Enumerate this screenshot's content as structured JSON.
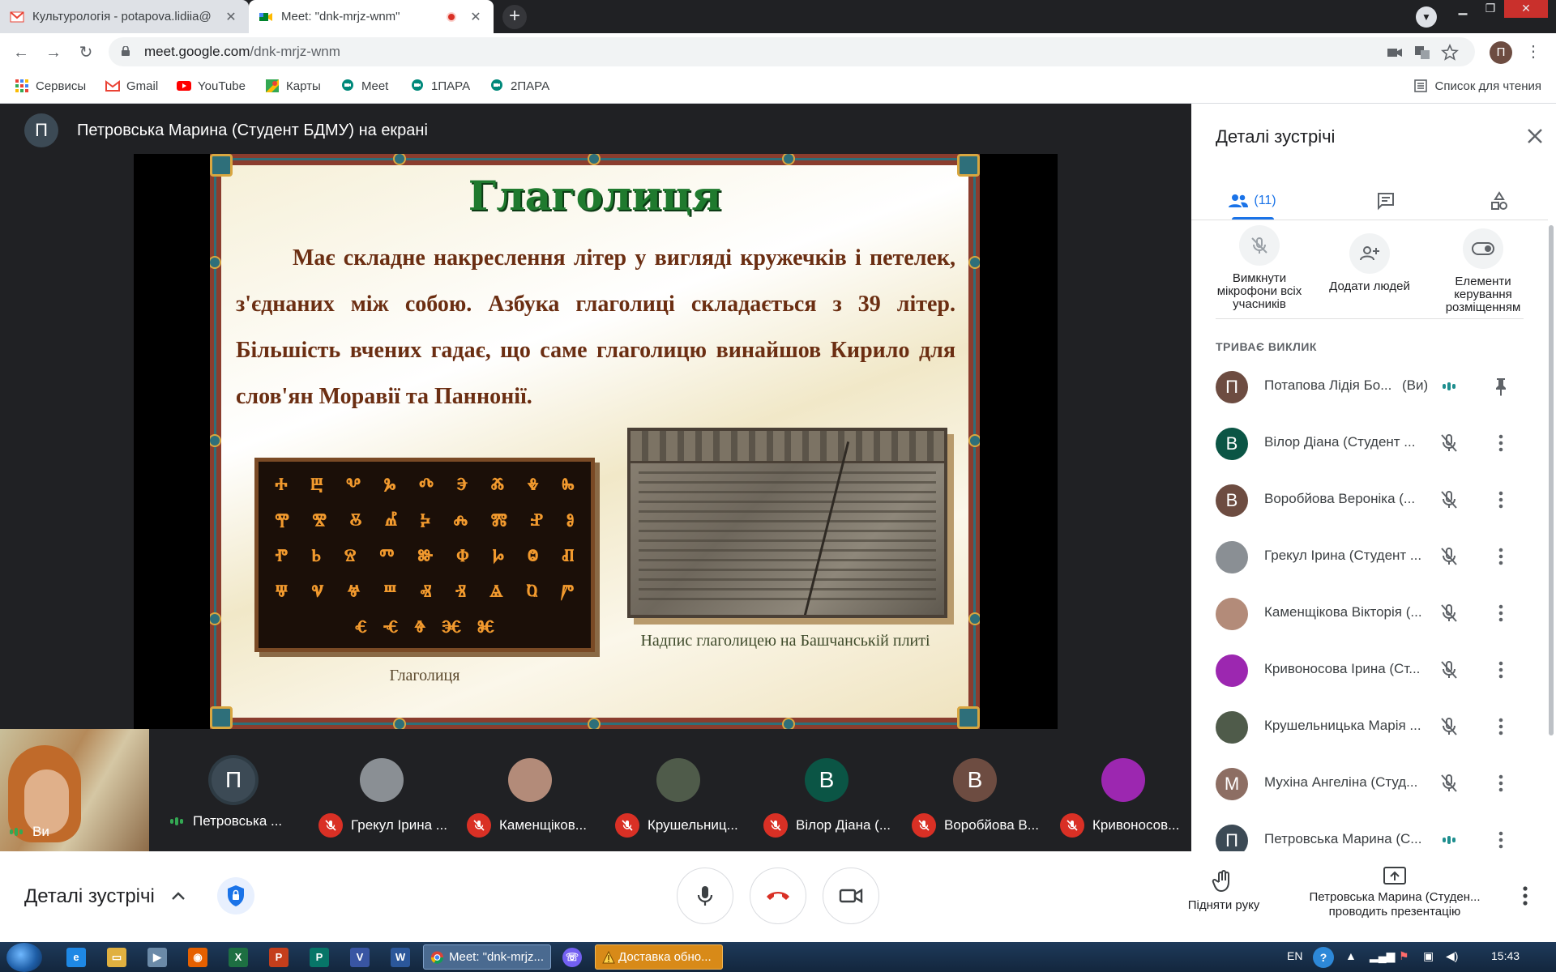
{
  "browser": {
    "tabs": [
      {
        "title": "Культурологія - potapova.lidiia@",
        "active": false
      },
      {
        "title": "Meet: \"dnk-mrjz-wnm\"",
        "active": true
      }
    ],
    "close_glyph": "✕",
    "newtab_glyph": "+",
    "url_domain": "meet.google.com",
    "url_path": "/dnk-mrjz-wnm",
    "profile_initial": "П",
    "window_controls": {
      "minimize": "▁",
      "restore": "❐",
      "close": "✕"
    }
  },
  "bookmarks": {
    "items": [
      {
        "label": "Сервисы",
        "icon": "apps-grid-icon"
      },
      {
        "label": "Gmail",
        "icon": "gmail-icon"
      },
      {
        "label": "YouTube",
        "icon": "youtube-icon"
      },
      {
        "label": "Карты",
        "icon": "maps-icon"
      },
      {
        "label": "Meet",
        "icon": "meet-icon"
      },
      {
        "label": "1ПАРА",
        "icon": "meet-icon"
      },
      {
        "label": "2ПАРА",
        "icon": "meet-icon"
      }
    ],
    "reading_list": "Список для чтения"
  },
  "stage": {
    "presenter_initial": "П",
    "presenter_text": "Петровська Марина (Студент БДМУ) на екрані"
  },
  "slide": {
    "title": "Глаголиця",
    "body": "Має складне накреслення літер у вигляді кружечків і петелек, з'єднаних між собою. Азбука глаголиці складається з 39 літер. Більшість вчених гадає, що саме глаголицю винайшов Кирило для слов'ян Моравії та Паннонії.",
    "glyph_rows": [
      [
        "ⰰ",
        "ⰱ",
        "ⰲ",
        "ⰳ",
        "ⰴ",
        "ⰵ",
        "ⰶ",
        "ⰷ",
        "ⰸ"
      ],
      [
        "ⰹ",
        "ⰺ",
        "ⰻ",
        "ⰼ",
        "ⰽ",
        "ⰾ",
        "ⰿ",
        "ⱀ",
        "ⱁ"
      ],
      [
        "ⱂ",
        "ⱃ",
        "ⱄ",
        "ⱅ",
        "ⱆ",
        "ⱇ",
        "ⱈ",
        "ⱉ",
        "ⱊ"
      ],
      [
        "ⱋ",
        "ⱌ",
        "ⱍ",
        "ⱎ",
        "ⱏ",
        "ⱐ",
        "ⱑ",
        "ⱒ",
        "ⱓ"
      ],
      [
        "ⱔ",
        "ⱕ",
        "ⱖ",
        "ⱗ",
        "ⱘ"
      ]
    ],
    "glyph_caption": "Глаголиця",
    "stone_caption": "Надпис глаголицею на Башчанській плиті"
  },
  "filmstrip": {
    "self": {
      "label": "Ви"
    },
    "tiles": [
      {
        "name": "Петровська ...",
        "initial": "П",
        "avatar_color": "#3c4a55",
        "muted": false,
        "speaking": true
      },
      {
        "name": "Грекул Ірина ...",
        "initial": "",
        "avatar_color": "#8a8f94",
        "muted": true,
        "speaking": false
      },
      {
        "name": "Каменщіков...",
        "initial": "",
        "avatar_color": "#b38b79",
        "muted": true,
        "speaking": false
      },
      {
        "name": "Крушельниц...",
        "initial": "",
        "avatar_color": "#4f5b4a",
        "muted": true,
        "speaking": false
      },
      {
        "name": "Вілор Діана (...",
        "initial": "В",
        "avatar_color": "#0b5545",
        "muted": true,
        "speaking": false
      },
      {
        "name": "Воробйова В...",
        "initial": "В",
        "avatar_color": "#6d4c41",
        "muted": true,
        "speaking": false
      },
      {
        "name": "Кривоносов...",
        "initial": "",
        "avatar_color": "#9c27b0",
        "muted": true,
        "speaking": false
      }
    ]
  },
  "panel": {
    "title": "Деталі зустрічі",
    "people_count": "(11)",
    "actions": [
      {
        "label": "Вимкнути мікрофони всіх учасників",
        "icon": "mic-off-icon"
      },
      {
        "label": "Додати людей",
        "icon": "person-add-icon"
      },
      {
        "label": "Елементи керування розміщенням",
        "icon": "toggle-icon"
      }
    ],
    "section_label": "ТРИВАЄ ВИКЛИК",
    "participants": [
      {
        "name": "Потапова Лідія Бо...",
        "you": "(Ви)",
        "initial": "П",
        "color": "#6d4c41",
        "status": "speaking",
        "action": "pin"
      },
      {
        "name": "Вілор Діана (Студент ...",
        "you": "",
        "initial": "В",
        "color": "#0b5545",
        "status": "muted",
        "action": "more"
      },
      {
        "name": "Воробйова Вероніка (...",
        "you": "",
        "initial": "В",
        "color": "#6d4c41",
        "status": "muted",
        "action": "more"
      },
      {
        "name": "Грекул Ірина (Студент ...",
        "you": "",
        "initial": "",
        "color": "#8a8f94",
        "status": "muted",
        "action": "more"
      },
      {
        "name": "Каменщікова Вікторія (...",
        "you": "",
        "initial": "",
        "color": "#b38b79",
        "status": "muted",
        "action": "more"
      },
      {
        "name": "Кривоносова Ірина (Ст...",
        "you": "",
        "initial": "",
        "color": "#9c27b0",
        "status": "muted",
        "action": "more"
      },
      {
        "name": "Крушельницька Марія ...",
        "you": "",
        "initial": "",
        "color": "#4f5b4a",
        "status": "muted",
        "action": "more"
      },
      {
        "name": "Мухіна Ангеліна (Студ...",
        "you": "",
        "initial": "М",
        "color": "#8d6e63",
        "status": "muted",
        "action": "more"
      },
      {
        "name": "Петровська Марина (С...",
        "you": "",
        "initial": "П",
        "color": "#3c4a55",
        "status": "speaking",
        "action": "more"
      }
    ]
  },
  "controls": {
    "details_label": "Деталі зустрічі",
    "raise_hand": "Підняти руку",
    "presenting_name": "Петровська Марина (Студен...",
    "presenting_suffix": "проводить презентацію"
  },
  "taskbar": {
    "tasks": [
      {
        "label": "Meet: \"dnk-mrjz...",
        "kind": "chrome"
      },
      {
        "label": "Доставка обно...",
        "kind": "warning"
      }
    ],
    "lang": "EN",
    "time": "15:43",
    "pinned_icons": [
      "ie-icon",
      "explorer-icon",
      "media-player-icon",
      "firefox-icon",
      "excel-icon",
      "powerpoint-icon",
      "publisher-icon",
      "visio-icon",
      "word-icon"
    ]
  },
  "colors": {
    "meet_dark": "#202124",
    "accent_blue": "#1a73e8",
    "mute_red": "#d93025",
    "speak_green": "#34a853"
  }
}
